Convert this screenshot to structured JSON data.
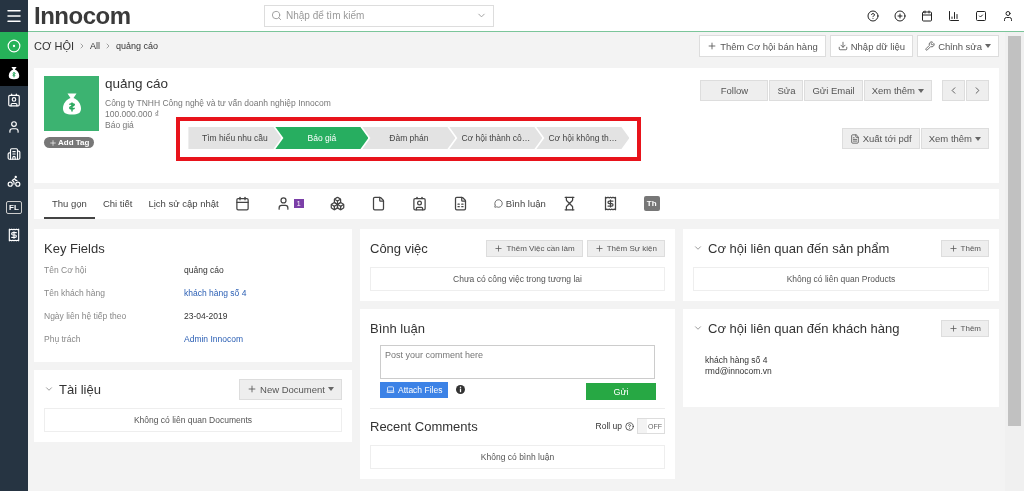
{
  "sidebar": {
    "items": [
      {
        "kind": "target",
        "selected": false
      },
      {
        "kind": "moneybag",
        "selected": true
      },
      {
        "kind": "contact",
        "selected": false
      },
      {
        "kind": "user",
        "selected": false
      },
      {
        "kind": "building",
        "selected": false
      },
      {
        "kind": "bike",
        "selected": false
      },
      {
        "kind": "tag",
        "label": "FL",
        "selected": false
      },
      {
        "kind": "invoice",
        "selected": false
      }
    ]
  },
  "topbar": {
    "logo": "Innocom",
    "search": {
      "placeholder": "Nhập để tìm kiếm"
    }
  },
  "breadcrumb": [
    "CƠ HỘI",
    "All",
    "quảng cáo"
  ],
  "page_actions": [
    {
      "label": "Thêm Cơ hội bán hàng",
      "kind": "plus"
    },
    {
      "label": "Nhập dữ liệu",
      "kind": "download"
    },
    {
      "label": "Chỉnh sửa",
      "kind": "wrench",
      "dropdown": true
    }
  ],
  "record": {
    "title": "quảng cáo",
    "company": "Công ty TNHH Công nghệ và tư vấn doanh nghiệp Innocom",
    "amount": "100.000.000 ₫",
    "stage": "Báo giá",
    "add_tag": "Add Tag",
    "actions": [
      {
        "label": "Follow",
        "dropdown": false
      },
      {
        "label": "Sửa",
        "dropdown": false
      },
      {
        "label": "Gửi Email",
        "dropdown": false
      },
      {
        "label": "Xem thêm",
        "dropdown": true
      }
    ],
    "pipeline": {
      "highlighted": true,
      "stages": [
        {
          "label": "Tìm hiểu nhu cầu",
          "selected": false
        },
        {
          "label": "Báo giá",
          "selected": true
        },
        {
          "label": "Đàm phán",
          "selected": false
        },
        {
          "label": "Cơ hội thành cô…",
          "selected": false
        },
        {
          "label": "Cơ hội không th…",
          "selected": false
        }
      ]
    },
    "export_actions": [
      {
        "label": "Xuất tới pdf",
        "kind": "file",
        "dropdown": false
      },
      {
        "label": "Xem thêm",
        "kind": "plain",
        "dropdown": true
      }
    ]
  },
  "tabs": [
    {
      "kind": "text",
      "label": "Thu gọn",
      "selected": true
    },
    {
      "kind": "text",
      "label": "Chi tiết",
      "selected": false
    },
    {
      "kind": "text",
      "label": "Lịch sử cập nhật",
      "selected": false
    },
    {
      "kind": "calendar",
      "selected": false
    },
    {
      "kind": "user",
      "badge": "1",
      "selected": false
    },
    {
      "kind": "boxes",
      "selected": false
    },
    {
      "kind": "document",
      "selected": false
    },
    {
      "kind": "contact",
      "selected": false
    },
    {
      "kind": "sheet",
      "selected": false
    },
    {
      "kind": "comment",
      "label": "Bình luận",
      "selected": false
    },
    {
      "kind": "hourglass",
      "selected": false
    },
    {
      "kind": "invoice",
      "selected": false
    },
    {
      "kind": "avatar",
      "label": "Th",
      "selected": false
    }
  ],
  "key_fields": {
    "title": "Key Fields",
    "rows": [
      {
        "label": "Tên Cơ hội",
        "value": "quảng cáo",
        "link": false
      },
      {
        "label": "Tên khách hàng",
        "value": "khách hàng số 4",
        "link": true
      },
      {
        "label": "Ngày liên hệ tiếp theo",
        "value": "23-04-2019",
        "link": false
      },
      {
        "label": "Phụ trách",
        "value": "Admin Innocom",
        "link": true
      }
    ]
  },
  "documents": {
    "title": "Tài liệu",
    "button": "New Document",
    "empty": "Không có liên quan Documents"
  },
  "tasks": {
    "title": "Công việc",
    "buttons": [
      "Thêm Việc cần làm",
      "Thêm Sự kiện"
    ],
    "empty": "Chưa có công việc trong tương lai"
  },
  "comments": {
    "title": "Bình luận",
    "placeholder": "Post your comment here",
    "attach": "Attach Files",
    "send": "Gửi",
    "recent_title": "Recent Comments",
    "rollup_label": "Roll up",
    "rollup": {
      "on": false,
      "off_label": "OFF"
    },
    "empty": "Không có bình luận"
  },
  "related_products": {
    "title": "Cơ hội liên quan đến sản phẩm",
    "button": "Thêm",
    "empty": "Không có liên quan Products"
  },
  "related_customers": {
    "title": "Cơ hội liên quan đến khách hàng",
    "button": "Thêm",
    "lines": [
      "khách hàng số 4",
      "rmd@innocom.vn"
    ]
  }
}
